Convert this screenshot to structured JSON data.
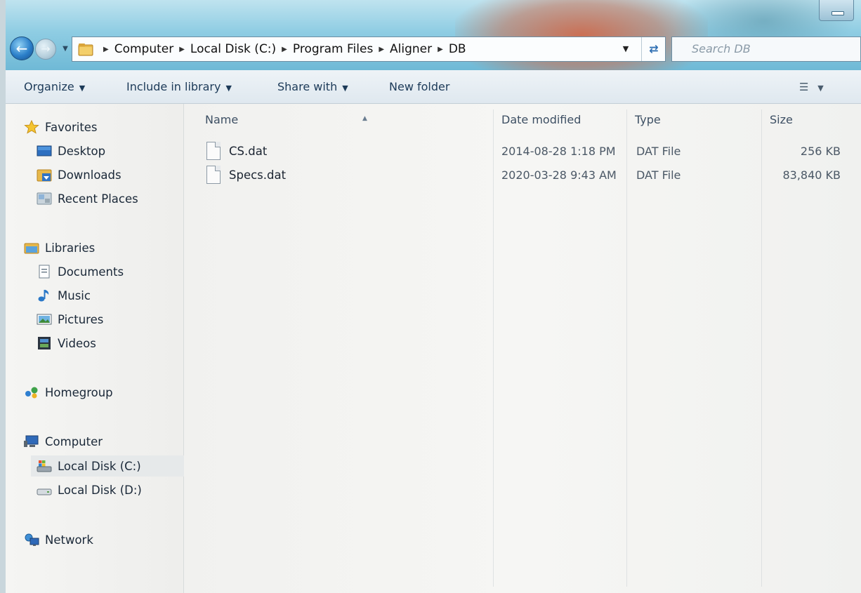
{
  "address": {
    "crumbs": [
      "Computer",
      "Local Disk (C:)",
      "Program Files",
      "Aligner",
      "DB"
    ]
  },
  "search": {
    "placeholder": "Search DB"
  },
  "toolbar": {
    "organize": "Organize",
    "include_in_library": "Include in library",
    "share_with": "Share with",
    "new_folder": "New folder"
  },
  "nav": {
    "favorites": "Favorites",
    "desktop": "Desktop",
    "downloads": "Downloads",
    "recent_places": "Recent Places",
    "libraries": "Libraries",
    "documents": "Documents",
    "music": "Music",
    "pictures": "Pictures",
    "videos": "Videos",
    "homegroup": "Homegroup",
    "computer": "Computer",
    "local_disk_c": "Local Disk (C:)",
    "local_disk_d": "Local Disk (D:)",
    "network": "Network"
  },
  "columns": {
    "name": "Name",
    "date_modified": "Date modified",
    "type": "Type",
    "size": "Size"
  },
  "files": [
    {
      "name": "CS.dat",
      "date": "2014-08-28 1:18 PM",
      "type": "DAT File",
      "size": "256 KB"
    },
    {
      "name": "Specs.dat",
      "date": "2020-03-28 9:43 AM",
      "type": "DAT File",
      "size": "83,840 KB"
    }
  ],
  "colors": {
    "accent": "#2b7fc9",
    "command_text": "#1c3a58",
    "selected_background": "#e6e9ea"
  }
}
